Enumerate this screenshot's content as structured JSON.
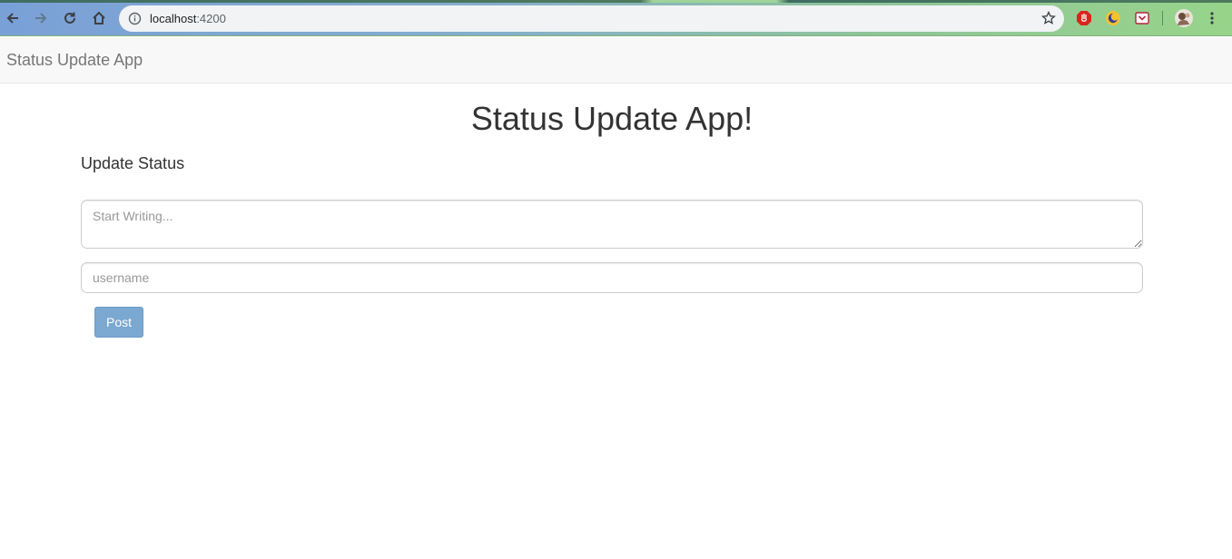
{
  "browser": {
    "url_host": "localhost",
    "url_port": ":4200",
    "icons": [
      "back-arrow-icon",
      "forward-arrow-icon",
      "reload-icon",
      "home-icon",
      "info-icon",
      "bookmark-star-icon",
      "adblock-extension-icon",
      "moon-extension-icon",
      "pocket-extension-icon",
      "profile-avatar",
      "menu-kebab-icon"
    ]
  },
  "navbar": {
    "brand": "Status Update App"
  },
  "main": {
    "title": "Status Update App!",
    "section_label": "Update Status",
    "status_placeholder": "Start Writing...",
    "status_value": "",
    "username_placeholder": "username",
    "username_value": "",
    "post_label": "Post"
  },
  "colors": {
    "post_button": "#7aa8d1",
    "navbar_bg": "#f8f8f8",
    "brand_text": "#777777"
  }
}
